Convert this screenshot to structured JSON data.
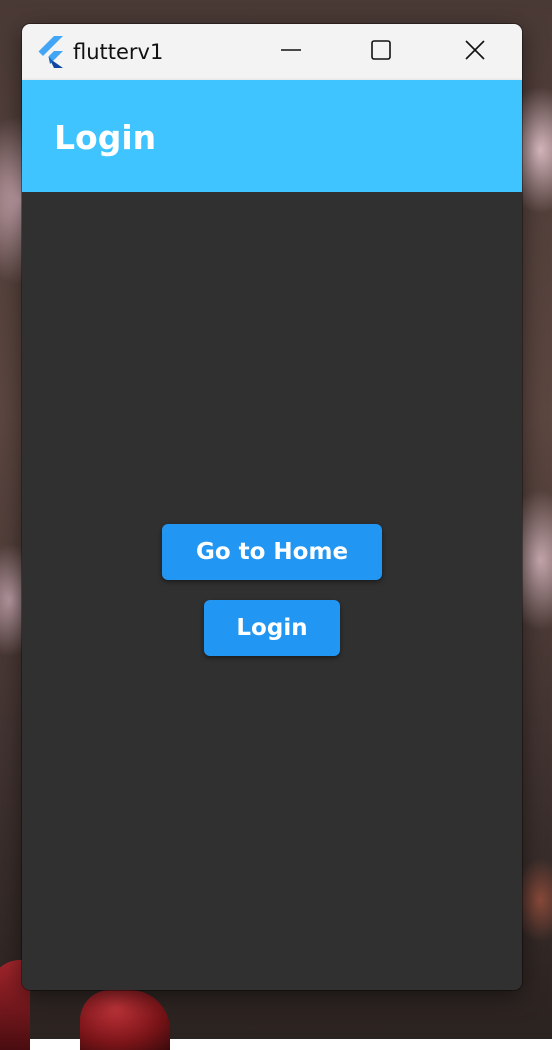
{
  "window": {
    "title": "flutterv1",
    "icon": "flutter-logo-icon",
    "controls": {
      "minimize_icon": "minimize-icon",
      "maximize_icon": "maximize-icon",
      "close_icon": "close-icon"
    }
  },
  "appbar": {
    "title": "Login",
    "color": "#40c4ff"
  },
  "content": {
    "background": "#303030",
    "buttons": [
      {
        "label": "Go to Home",
        "color": "#2196f3"
      },
      {
        "label": "Login",
        "color": "#2196f3"
      }
    ]
  }
}
